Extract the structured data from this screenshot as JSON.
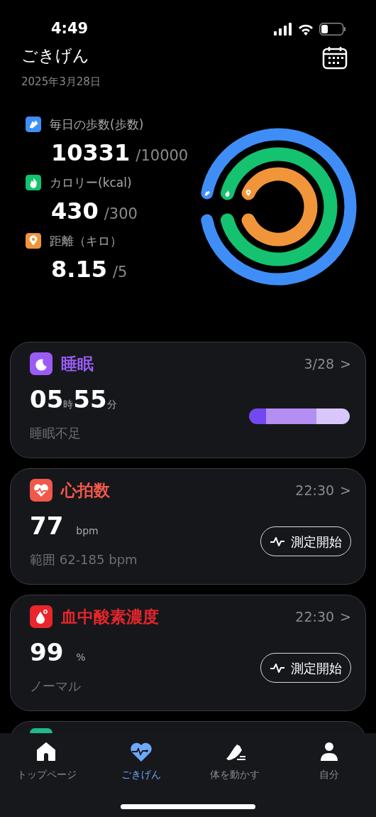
{
  "status_bar": {
    "time": "4:49"
  },
  "header": {
    "title": "ごきげん",
    "date": "2025年3月28日"
  },
  "metrics": [
    {
      "label": "毎日の歩数(歩数)",
      "value": "10331",
      "goal": "/10000",
      "color": "#3f8ef8"
    },
    {
      "label": "カロリー(kcal)",
      "value": "430",
      "goal": "/300",
      "color": "#14c26f"
    },
    {
      "label": "距離（キロ）",
      "value": "8.15",
      "goal": "/5",
      "color": "#f0953a"
    }
  ],
  "cards": [
    {
      "kind": "sleep",
      "title": "睡眠",
      "color": "#9b5cf6",
      "time": "3/28",
      "chevron": ">",
      "value_parts": [
        {
          "text": "05",
          "kind": "number"
        },
        {
          "text": "時",
          "kind": "unit"
        },
        {
          "text": "55",
          "kind": "number"
        },
        {
          "text": "分",
          "kind": "unit"
        }
      ],
      "note": "睡眠不足",
      "segments": [
        {
          "color": "#7448ef"
        },
        {
          "color": "#b48ef3"
        },
        {
          "color": "#d9c6fb"
        }
      ]
    },
    {
      "kind": "measure",
      "title": "心拍数",
      "color": "#f0584a",
      "time": "22:30",
      "chevron": ">",
      "value": "77",
      "unit": "bpm",
      "note": "範囲 62-185 bpm",
      "button": "測定開始"
    },
    {
      "kind": "measure",
      "title": "血中酸素濃度",
      "color": "#e8262b",
      "time": "22:30",
      "chevron": ">",
      "value": "99",
      "unit": "%",
      "note": "ノーマル",
      "button": "測定開始"
    },
    {
      "kind": "covered",
      "color": "#22b98a"
    }
  ],
  "tabs": [
    {
      "label": "トップページ",
      "selected": false
    },
    {
      "label": "ごきげん",
      "selected": true
    },
    {
      "label": "体を動かす",
      "selected": false
    },
    {
      "label": "自分",
      "selected": false
    }
  ]
}
